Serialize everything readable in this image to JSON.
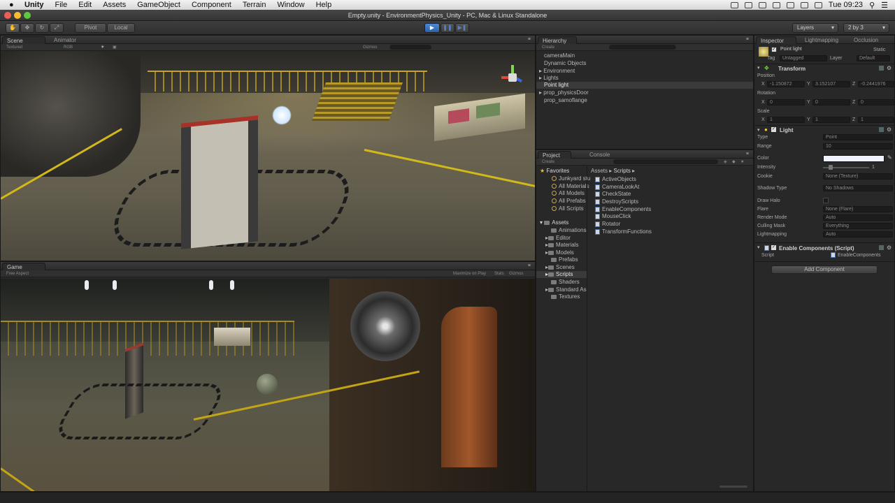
{
  "menubar": {
    "app": "Unity",
    "items": [
      "File",
      "Edit",
      "Assets",
      "GameObject",
      "Component",
      "Terrain",
      "Window",
      "Help"
    ],
    "clock": "Tue 09:23"
  },
  "window": {
    "title": "Empty.unity - EnvironmentPhysics_Unity - PC, Mac & Linux Standalone"
  },
  "toolbar": {
    "pivot": "Pivot",
    "local": "Local",
    "layers": "Layers",
    "layout": "2 by 3"
  },
  "scene": {
    "tab_scene": "Scene",
    "tab_animator": "Animator",
    "shading": "Textured",
    "rgb": "RGB",
    "gizmos": "Gizmos"
  },
  "game": {
    "tab": "Game",
    "aspect": "Free Aspect",
    "maximize": "Maximize on Play",
    "stats": "Stats",
    "gizmos": "Gizmos"
  },
  "hierarchy": {
    "tab": "Hierarchy",
    "create": "Create",
    "items": [
      "cameraMain",
      "Dynamic Objects",
      "Environment",
      "Lights",
      "Point light",
      "prop_physicsDoor",
      "prop_samoflange"
    ],
    "selected": "Point light"
  },
  "project": {
    "tab": "Project",
    "tab_console": "Console",
    "create": "Create",
    "favorites_label": "Favorites",
    "favorites": [
      "Junkyard stu",
      "All Materials",
      "All Models",
      "All Prefabs",
      "All Scripts"
    ],
    "assets_label": "Assets",
    "folders": [
      "Animations",
      "Editor",
      "Materials",
      "Models",
      "Prefabs",
      "Scenes",
      "Scripts",
      "Shaders",
      "Standard As",
      "Textures"
    ],
    "breadcrumb_assets": "Assets",
    "breadcrumb_scripts": "Scripts",
    "scripts": [
      "ActiveObjects",
      "CameraLookAt",
      "CheckState",
      "DestroyScripts",
      "EnableComponents",
      "MouseClick",
      "Rotator",
      "TransformFunctions"
    ]
  },
  "inspector": {
    "tab": "Inspector",
    "tab_lightmapping": "Lightmapping",
    "tab_occlusion": "Occlusion",
    "object_name": "Point light",
    "static": "Static",
    "tag_label": "Tag",
    "tag_value": "Untagged",
    "layer_label": "Layer",
    "layer_value": "Default",
    "transform": {
      "title": "Transform",
      "position": "Position",
      "rotation": "Rotation",
      "scale": "Scale",
      "pos": [
        "-1.150872",
        "3.152107",
        "-0.2441976"
      ],
      "rot": [
        "0",
        "0",
        "0"
      ],
      "scl": [
        "1",
        "1",
        "1"
      ]
    },
    "light": {
      "title": "Light",
      "type_label": "Type",
      "type": "Point",
      "range_label": "Range",
      "range": "10",
      "color_label": "Color",
      "intensity_label": "Intensity",
      "intensity": "1",
      "cookie_label": "Cookie",
      "cookie": "None (Texture)",
      "shadow_label": "Shadow Type",
      "shadow": "No Shadows",
      "halo_label": "Draw Halo",
      "flare_label": "Flare",
      "flare": "None (Flare)",
      "render_label": "Render Mode",
      "render": "Auto",
      "culling_label": "Culling Mask",
      "culling": "Everything",
      "lm_label": "Lightmapping",
      "lm": "Auto"
    },
    "script": {
      "title": "Enable Components (Script)",
      "script_label": "Script",
      "script_value": "EnableComponents"
    },
    "add_component": "Add Component"
  }
}
